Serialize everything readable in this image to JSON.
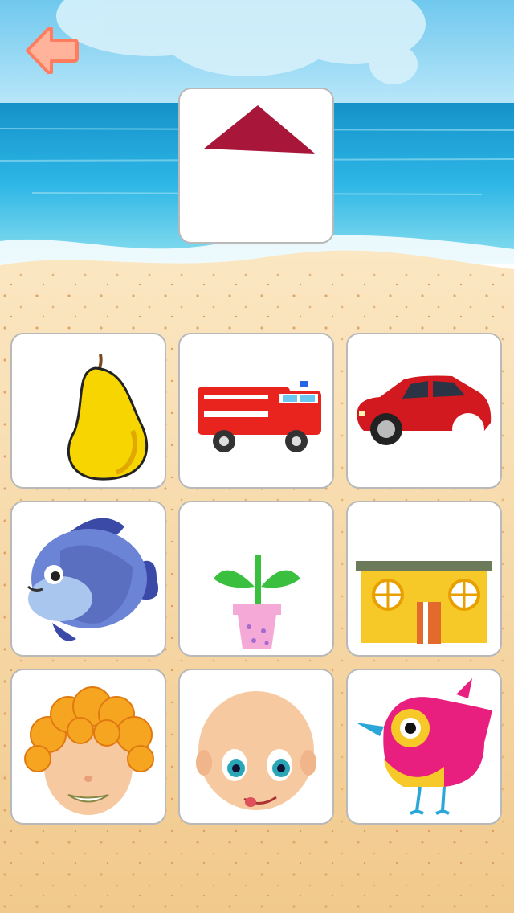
{
  "game": {
    "target_shape": "triangle-roof",
    "target_color": "#a8173a",
    "choices": [
      {
        "id": "pear",
        "icon": "pear-icon"
      },
      {
        "id": "fire-truck",
        "icon": "fire-truck-icon"
      },
      {
        "id": "car",
        "icon": "car-icon"
      },
      {
        "id": "fish",
        "icon": "fish-icon"
      },
      {
        "id": "plant",
        "icon": "potted-plant-icon"
      },
      {
        "id": "house",
        "icon": "house-icon"
      },
      {
        "id": "boy",
        "icon": "curly-hair-boy-icon"
      },
      {
        "id": "girl",
        "icon": "girl-face-icon"
      },
      {
        "id": "bird",
        "icon": "bird-icon"
      }
    ]
  },
  "colors": {
    "sky": "#8fd6f2",
    "sea": "#27aee0",
    "sand": "#f6d9a8",
    "back_button": "#ff9a7a"
  }
}
